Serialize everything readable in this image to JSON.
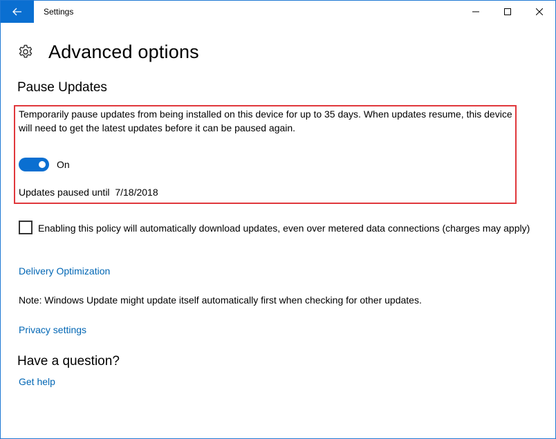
{
  "window": {
    "title": "Settings",
    "accent_color": "#0a6fd1",
    "back_icon": "arrow-left-icon",
    "controls": [
      "minimize-icon",
      "maximize-icon",
      "close-icon"
    ]
  },
  "header": {
    "icon": "gear-icon",
    "title": "Advanced options"
  },
  "pause_updates": {
    "section_title": "Pause Updates",
    "description": "Temporarily pause updates from being installed on this device for up to 35 days. When updates resume, this device will need to get the latest updates before it can be paused again.",
    "toggle_state": "On",
    "toggle_on": true,
    "paused_until_label": "Updates paused until  7/18/2018",
    "highlight_color": "#e0373b"
  },
  "metered": {
    "checked": false,
    "label": "Enabling this policy will automatically download updates, even over metered data connections (charges may apply)"
  },
  "links": {
    "delivery_optimization": "Delivery Optimization",
    "privacy_settings": "Privacy settings",
    "get_help": "Get help",
    "color": "#0066b4"
  },
  "note": "Note: Windows Update might update itself automatically first when checking for other updates.",
  "question": {
    "title": "Have a question?"
  }
}
